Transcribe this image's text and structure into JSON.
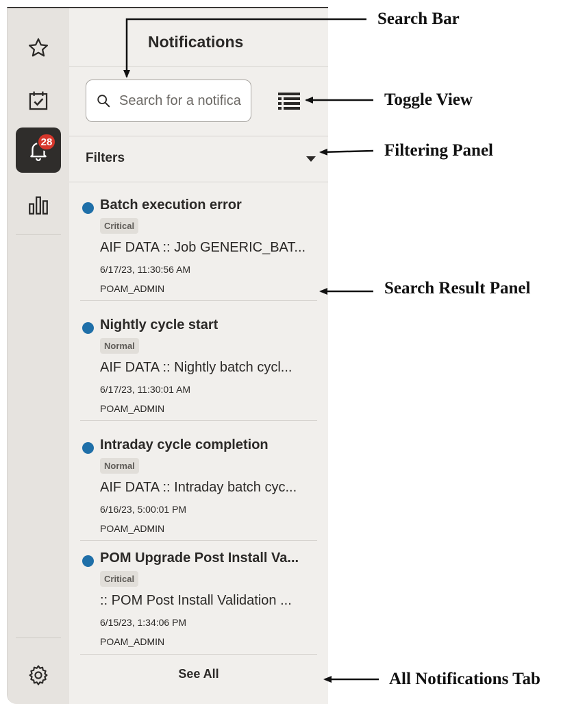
{
  "panel": {
    "title": "Notifications",
    "search": {
      "placeholder": "Search for a notifica",
      "value": ""
    },
    "filters_label": "Filters",
    "see_all_label": "See All"
  },
  "rail": {
    "badge_count": "28",
    "icons": [
      "star-icon",
      "calendar-check-icon",
      "bell-icon",
      "bar-chart-icon",
      "settings-gear-icon"
    ]
  },
  "notifications": [
    {
      "title": "Batch execution error",
      "severity": "Critical",
      "description": "AIF DATA :: Job GENERIC_BAT...",
      "timestamp": "6/17/23, 11:30:56 AM",
      "user": "POAM_ADMIN"
    },
    {
      "title": "Nightly cycle start",
      "severity": "Normal",
      "description": "AIF DATA :: Nightly batch cycl...",
      "timestamp": "6/17/23, 11:30:01 AM",
      "user": "POAM_ADMIN"
    },
    {
      "title": "Intraday cycle completion",
      "severity": "Normal",
      "description": "AIF DATA :: Intraday batch cyc...",
      "timestamp": "6/16/23, 5:00:01 PM",
      "user": "POAM_ADMIN"
    },
    {
      "title": "POM Upgrade Post Install Va...",
      "severity": "Critical",
      "description": ":: POM Post Install Validation ...",
      "timestamp": "6/15/23, 1:34:06 PM",
      "user": "POAM_ADMIN"
    }
  ],
  "annotations": {
    "search_bar": "Search Bar",
    "toggle_view": "Toggle View",
    "filtering_panel": "Filtering Panel",
    "search_result_panel": "Search Result Panel",
    "all_notifications_tab": "All Notifications Tab"
  },
  "colors": {
    "unread_dot": "#1f6fa8",
    "badge": "#d6362b",
    "active_rail": "#2f2d2b",
    "panel_bg": "#f1efec",
    "rail_bg": "#e6e3df"
  }
}
